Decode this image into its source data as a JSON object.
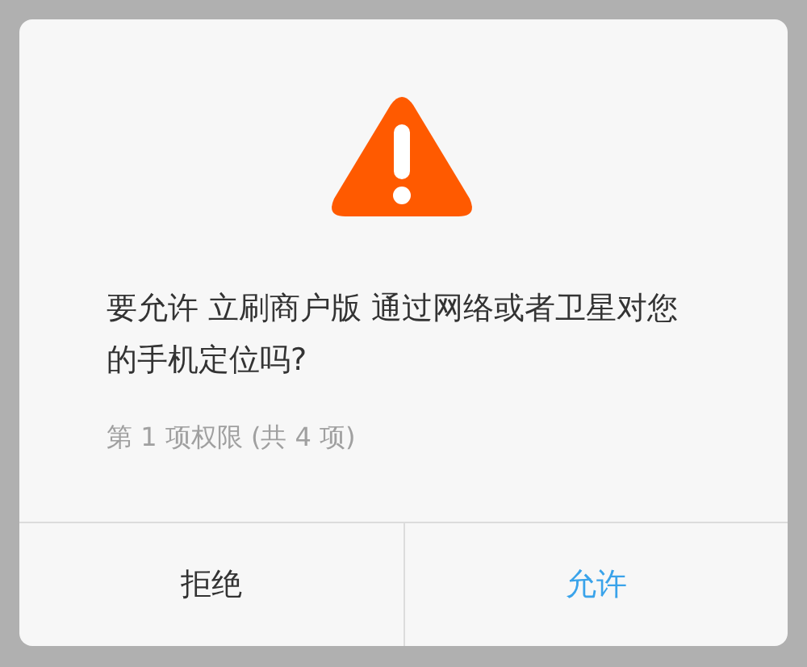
{
  "dialog": {
    "message": "要允许 立刷商户版 通过网络或者卫星对您的手机定位吗?",
    "progress": "第 1 项权限 (共 4 项)",
    "buttons": [
      {
        "label": "拒绝",
        "kind": "deny"
      },
      {
        "label": "允许",
        "kind": "allow"
      }
    ]
  }
}
